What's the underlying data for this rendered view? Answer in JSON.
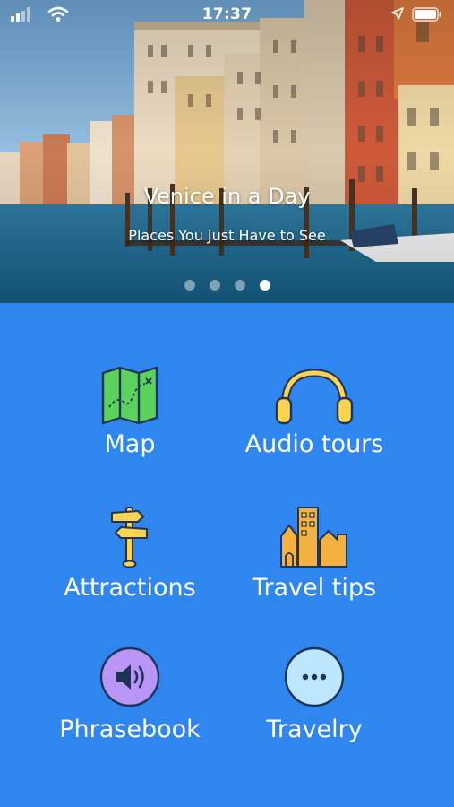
{
  "status_bar": {
    "time": "17:37",
    "icons": [
      "cellular-signal-icon",
      "wifi-icon",
      "location-arrow-icon",
      "battery-icon"
    ]
  },
  "hero": {
    "title": "Venice in a Day",
    "subtitle": "Places You Just Have to See",
    "carousel_pages": 4,
    "active_page": 4
  },
  "menu": {
    "items": [
      {
        "label": "Map",
        "icon": "map-icon"
      },
      {
        "label": "Audio tours",
        "icon": "headphones-icon"
      },
      {
        "label": "Attractions",
        "icon": "signpost-icon"
      },
      {
        "label": "Travel tips",
        "icon": "city-buildings-icon"
      },
      {
        "label": "Phrasebook",
        "icon": "speaker-icon"
      },
      {
        "label": "Travelry",
        "icon": "more-dots-icon"
      }
    ]
  },
  "colors": {
    "background": "#2f86ee",
    "icon_yellow": "#fcd34f",
    "icon_green": "#5bd25b",
    "icon_orange": "#f5b042",
    "icon_purple": "#b995f5",
    "icon_light_blue": "#bde6ff",
    "outline": "#1e3457"
  }
}
